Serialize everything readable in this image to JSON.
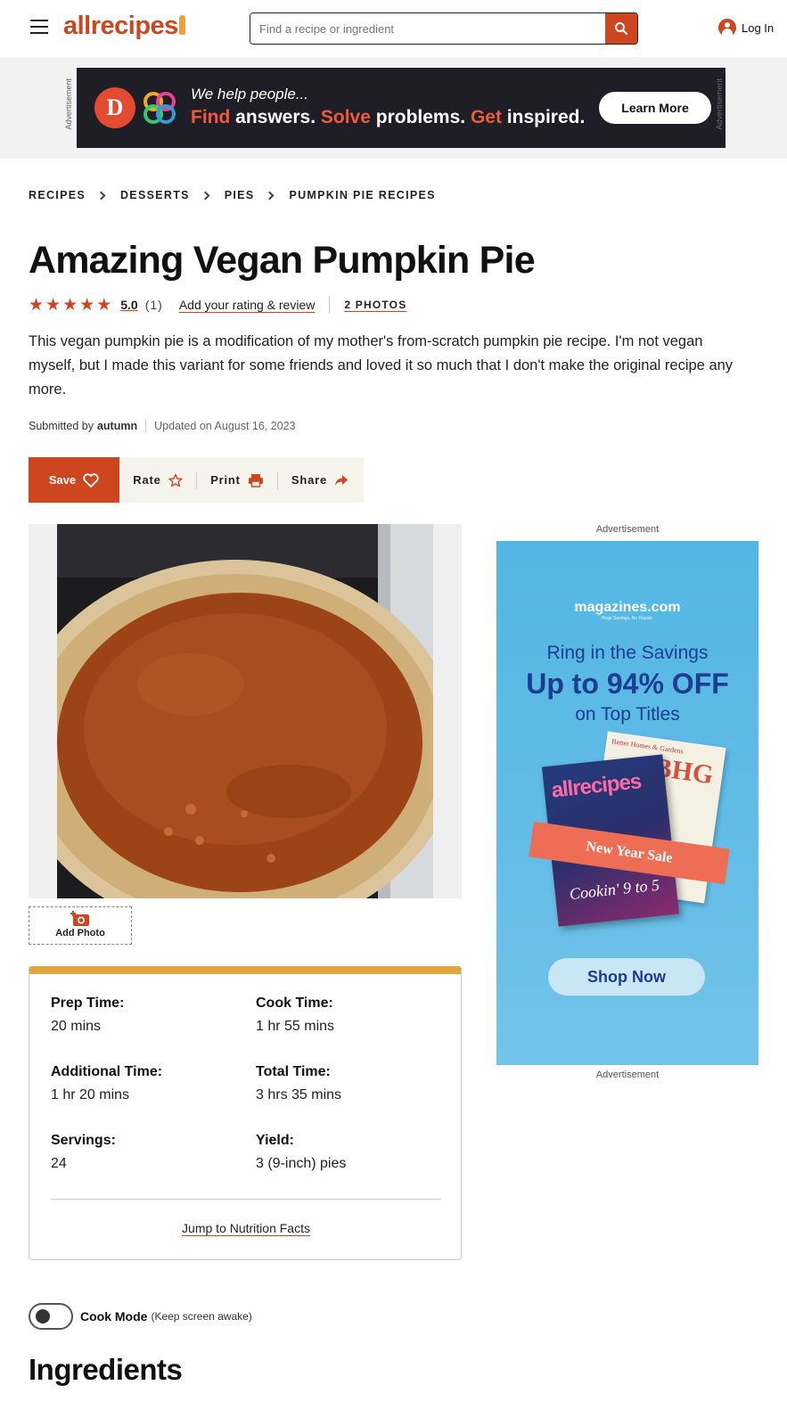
{
  "header": {
    "logo": "allrecipes",
    "search_placeholder": "Find a recipe or ingredient",
    "login_label": "Log In",
    "icons": [
      "menu-icon",
      "search-icon",
      "user-icon"
    ]
  },
  "top_ad": {
    "side_label": "Advertisement",
    "logo_letter": "D",
    "line1": "We help people...",
    "line2_parts": [
      "Find",
      " answers. ",
      "Solve",
      " problems. ",
      "Get",
      " inspired."
    ],
    "cta": "Learn More"
  },
  "breadcrumb": [
    "RECIPES",
    "DESSERTS",
    "PIES",
    "PUMPKIN PIE RECIPES"
  ],
  "recipe": {
    "title": "Amazing Vegan Pumpkin Pie",
    "rating": "5.0",
    "rating_stars": 5,
    "rating_count": "(1)",
    "add_rating_label": "Add your rating & review",
    "photos_label": "2 PHOTOS",
    "description": "This vegan pumpkin pie is a modification of my mother's from-scratch pumpkin pie recipe. I'm not vegan myself, but I made this variant for some friends and loved it so much that I don't make the original recipe any more.",
    "submitted_prefix": "Submitted by",
    "author": "autumn",
    "updated": "Updated on August 16, 2023"
  },
  "actions": {
    "save": "Save",
    "rate": "Rate",
    "print": "Print",
    "share": "Share"
  },
  "add_photo_label": "Add Photo",
  "details": {
    "items": [
      {
        "label": "Prep Time:",
        "value": "20 mins"
      },
      {
        "label": "Cook Time:",
        "value": "1 hr 55 mins"
      },
      {
        "label": "Additional Time:",
        "value": "1 hr 20 mins"
      },
      {
        "label": "Total Time:",
        "value": "3 hrs 35 mins"
      },
      {
        "label": "Servings:",
        "value": "24"
      },
      {
        "label": "Yield:",
        "value": "3 (9-inch) pies"
      }
    ],
    "jump_label": "Jump to Nutrition Facts",
    "accent_color": "#e0a63f"
  },
  "side_ad": {
    "label_top": "Advertisement",
    "label_bottom": "Advertisement",
    "brand": "magazines.com",
    "brand_tagline": "Huge Savings. No Hassle.",
    "line1": "Ring in the Savings",
    "line2": "Up to 94% OFF",
    "line3": "on Top Titles",
    "mag_back_header": "Better Homes & Gardens",
    "mag_back_title": "BHG",
    "mag_front_title": "allrecipes",
    "mag_front_cover": "Cookin' 9 to 5",
    "ribbon": "New Year Sale",
    "cta": "Shop Now"
  },
  "cook_mode": {
    "label": "Cook Mode",
    "note": "(Keep screen awake)",
    "enabled": false
  },
  "section_heading": "Ingredients",
  "colors": {
    "brand": "#ce4620",
    "action_bar_bg": "#f4f3ec"
  }
}
